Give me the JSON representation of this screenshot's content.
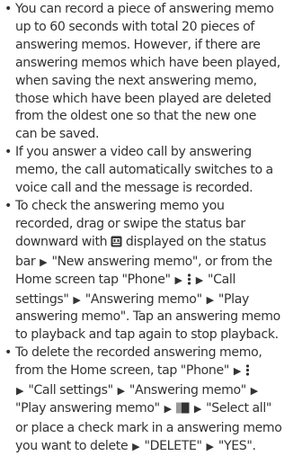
{
  "bullets": [
    {
      "lines": [
        "You can record a piece of answering memo",
        "up to 60 seconds with total 20 pieces of",
        "answering memos. However, if there are",
        "answering memos which have been played,",
        "when saving the next answering memo,",
        "those which have been played are deleted",
        "from the oldest one so that the new one",
        "can be saved."
      ]
    },
    {
      "lines": [
        "If you answer a video call by answering",
        "memo, the call automatically switches to a",
        "voice call and the message is recorded."
      ]
    },
    {
      "lines": [
        "To check the answering memo you",
        "recorded, drag or swipe the status bar",
        "downward with",
        "displayed on the status",
        "bar",
        "\"New answering memo\", or from the",
        "Home screen tap \"Phone\"",
        "\"Call",
        "settings\"",
        "\"Answering memo\"",
        "\"Play",
        "answering memo\". Tap an answering memo",
        "to playback and tap again to stop playback."
      ]
    },
    {
      "lines": [
        "To delete the recorded answering memo,",
        "from the Home screen, tap \"Phone\"",
        "\"Call settings\"",
        "\"Answering memo\"",
        "\"Play answering memo\"",
        "\"Select all\"",
        "or place a check mark in a answering memo",
        "you want to delete",
        "\"DELETE\"",
        "\"YES\"."
      ]
    }
  ],
  "glyphs": {
    "bullet": "•",
    "arrow": "▶"
  }
}
